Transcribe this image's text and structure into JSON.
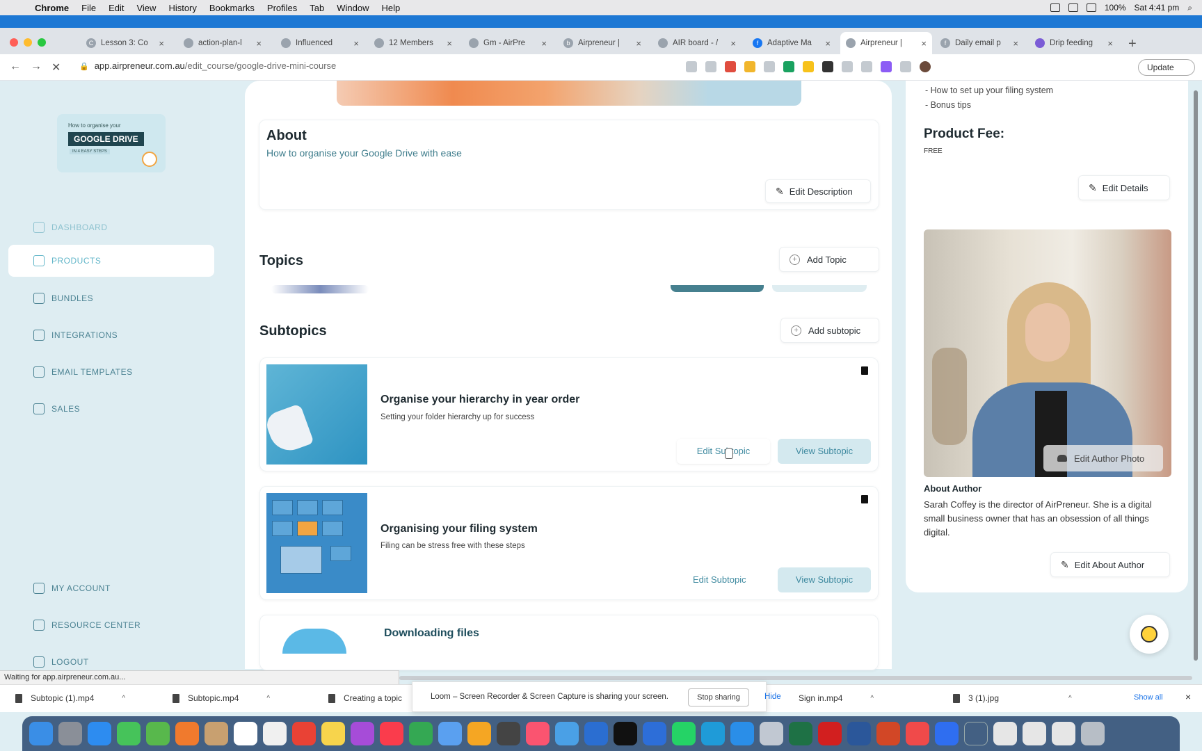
{
  "menubar": {
    "app": "Chrome",
    "items": [
      "File",
      "Edit",
      "View",
      "History",
      "Bookmarks",
      "Profiles",
      "Tab",
      "Window",
      "Help"
    ],
    "battery": "100%",
    "clock": "Sat 4:41 pm"
  },
  "tabs": [
    {
      "label": "Lesson 3: Co",
      "fav": "C"
    },
    {
      "label": "action-plan-l",
      "fav": ""
    },
    {
      "label": "Influenced",
      "fav": ""
    },
    {
      "label": "12 Members",
      "fav": ""
    },
    {
      "label": "Gm - AirPre",
      "fav": ""
    },
    {
      "label": "Airpreneur |",
      "fav": "b"
    },
    {
      "label": "AIR board - /",
      "fav": ""
    },
    {
      "label": "Adaptive Ma",
      "fav": "f"
    },
    {
      "label": "Airpreneur |",
      "fav": ""
    },
    {
      "label": "Daily email p",
      "fav": "f"
    },
    {
      "label": "Drip feeding",
      "fav": ""
    }
  ],
  "address": {
    "domain": "app.airpreneur.com.au",
    "path": "/edit_course/google-drive-mini-course",
    "update_label": "Update"
  },
  "sidebar": {
    "logo_line1": "How to organise your",
    "logo_line2": "GOOGLE DRIVE",
    "logo_line3": "IN 4 EASY STEPS",
    "items": [
      {
        "label": "DASHBOARD"
      },
      {
        "label": "PRODUCTS"
      },
      {
        "label": "BUNDLES"
      },
      {
        "label": "INTEGRATIONS"
      },
      {
        "label": "EMAIL TEMPLATES"
      },
      {
        "label": "SALES"
      },
      {
        "label": "MY ACCOUNT"
      },
      {
        "label": "RESOURCE CENTER"
      },
      {
        "label": "LOGOUT"
      }
    ]
  },
  "about": {
    "title": "About",
    "description": "How to organise your Google Drive with ease",
    "edit_button": "Edit Description"
  },
  "topics": {
    "title": "Topics",
    "add_button": "Add Topic"
  },
  "subtopics": {
    "title": "Subtopics",
    "add_button": "Add subtopic",
    "items": [
      {
        "title": "Organise your hierarchy in year order",
        "desc": "Setting your folder hierarchy up for success",
        "edit": "Edit Subtopic",
        "view": "View Subtopic"
      },
      {
        "title": "Organising your filing system",
        "desc": "Filing can be stress free with these steps",
        "edit": "Edit Subtopic",
        "view": "View Subtopic"
      },
      {
        "title": "Downloading files"
      }
    ]
  },
  "details": {
    "bullets": [
      "- How to set up your filing system",
      "- Bonus tips"
    ],
    "fee_label": "Product Fee:",
    "fee_value": "FREE",
    "edit_button": "Edit Details"
  },
  "author": {
    "edit_photo": "Edit Author Photo",
    "label": "About Author",
    "text": "Sarah Coffey is the director of AirPreneur.  She is a digital small business owner that has an obsession of all things digital.",
    "edit_button": "Edit About Author"
  },
  "status": "Waiting for app.airpreneur.com.au...",
  "downloads": {
    "files": [
      "Subtopic (1).mp4",
      "Subtopic.mp4",
      "Creating a topic",
      "Sign in.mp4",
      "3 (1).jpg"
    ],
    "show_all": "Show all"
  },
  "loom": {
    "message": "Loom – Screen Recorder & Screen Capture is sharing your screen.",
    "stop": "Stop sharing",
    "hide": "Hide"
  },
  "colors": {
    "accent": "#62b6c9",
    "sidebar_bg": "#deedf2",
    "button_tint": "#d4e9ef"
  }
}
